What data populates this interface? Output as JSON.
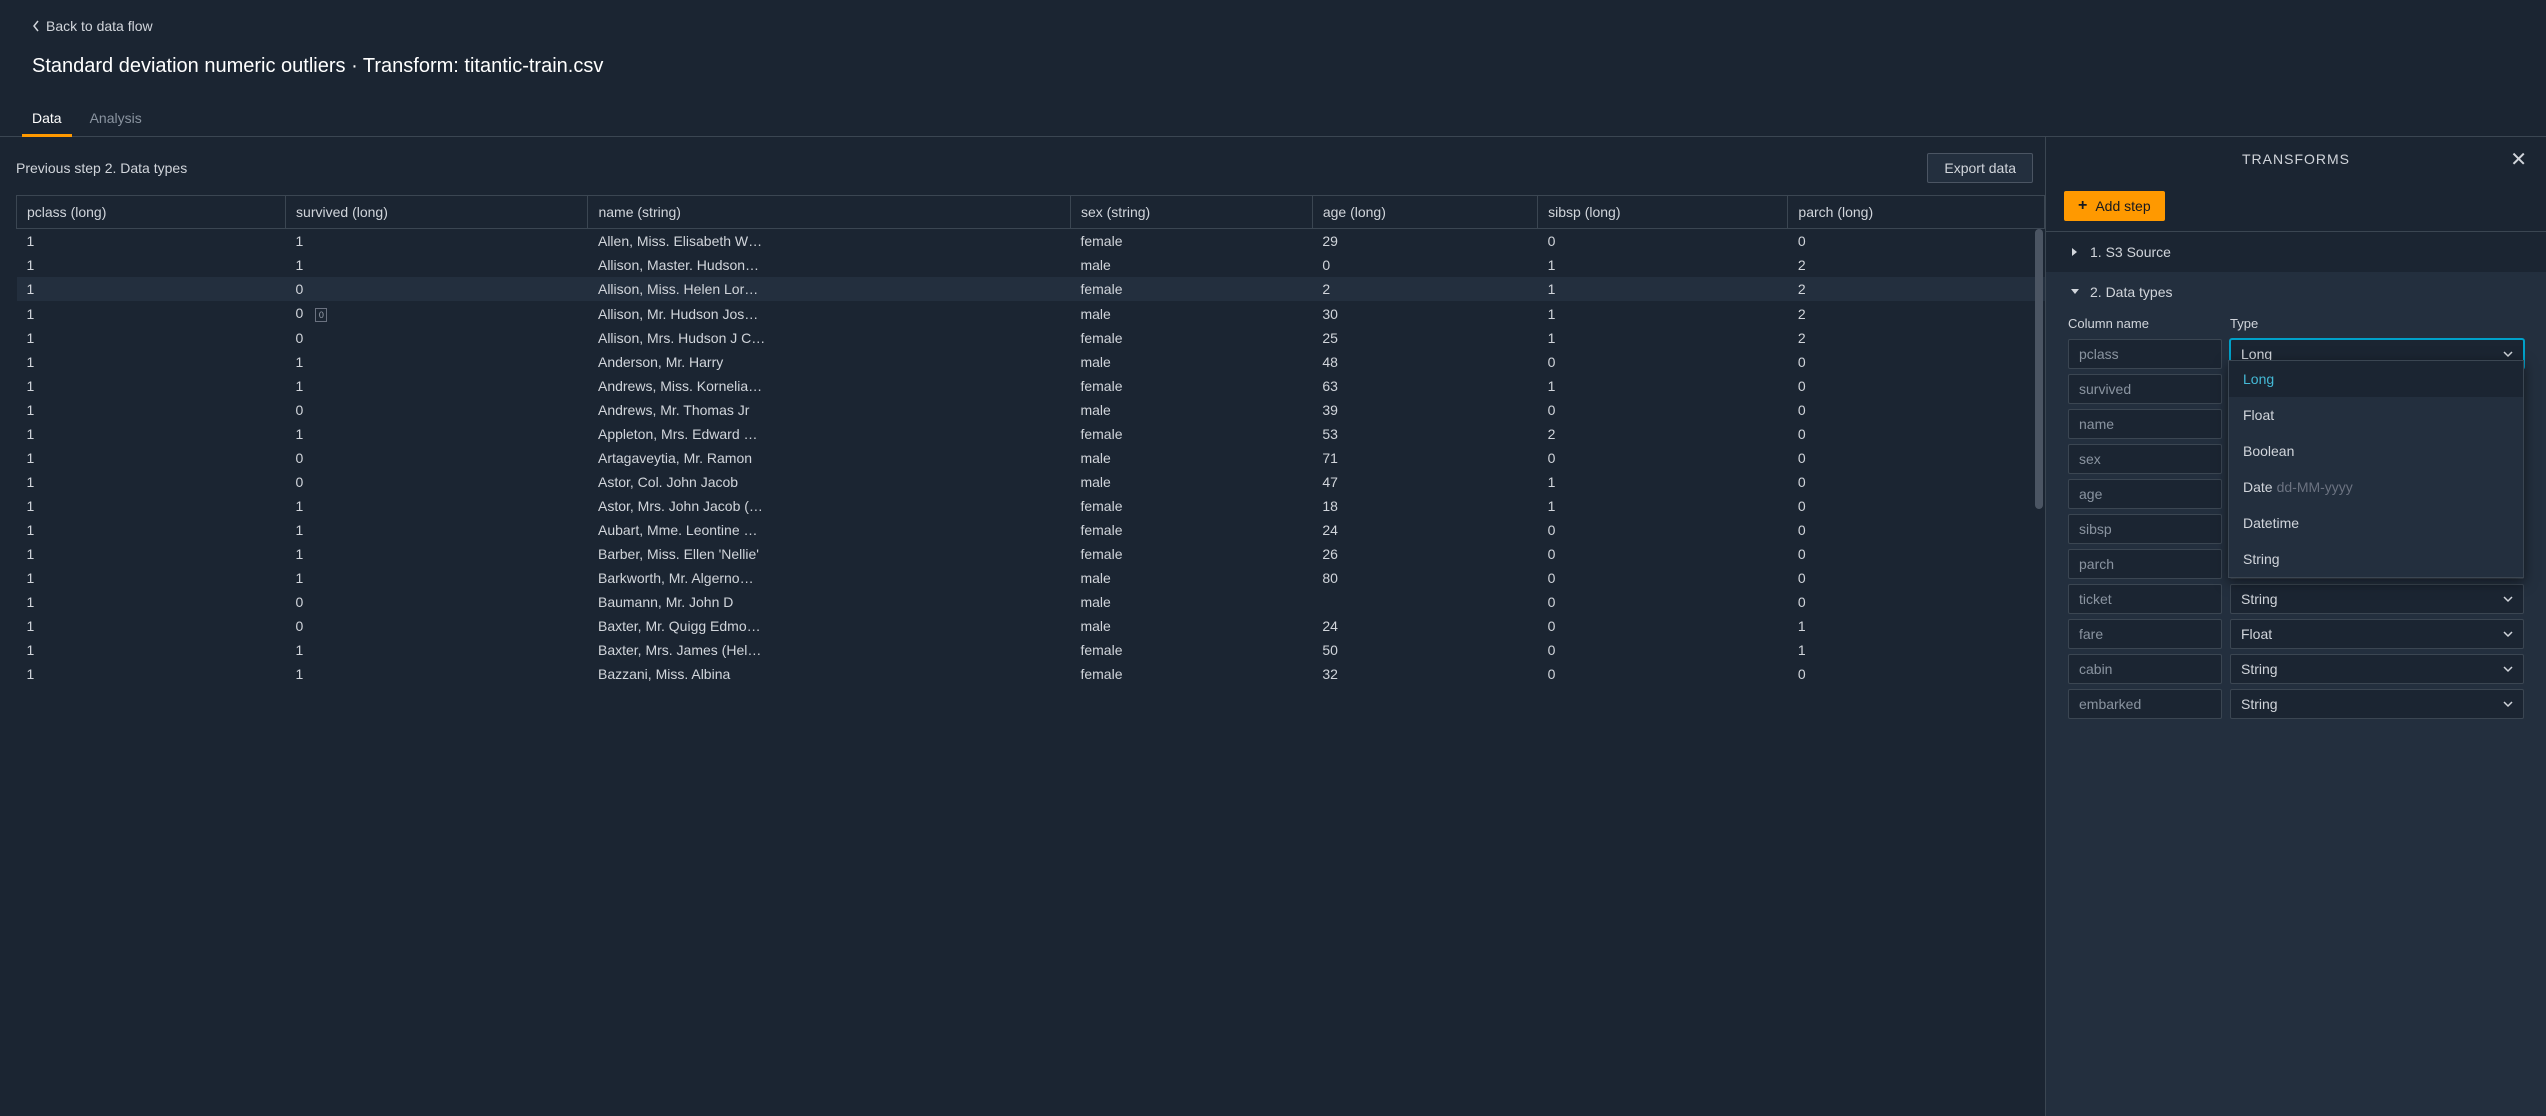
{
  "back_label": "Back to data flow",
  "title": "Standard deviation numeric outliers · Transform: titantic-train.csv",
  "tabs": {
    "data": "Data",
    "analysis": "Analysis"
  },
  "prev_step_label": "Previous step 2. Data types",
  "export_label": "Export data",
  "columns": [
    "pclass (long)",
    "survived (long)",
    "name (string)",
    "sex (string)",
    "age (long)",
    "sibsp (long)",
    "parch (long)"
  ],
  "rows": [
    {
      "pclass": "1",
      "survived": "1",
      "name": "Allen, Miss. Elisabeth W…",
      "sex": "female",
      "age": "29",
      "sibsp": "0",
      "parch": "0"
    },
    {
      "pclass": "1",
      "survived": "1",
      "name": "Allison, Master. Hudson…",
      "sex": "male",
      "age": "0",
      "sibsp": "1",
      "parch": "2"
    },
    {
      "pclass": "1",
      "survived": "0",
      "name": "Allison, Miss. Helen Lor…",
      "sex": "female",
      "age": "2",
      "sibsp": "1",
      "parch": "2",
      "highlight": true
    },
    {
      "pclass": "1",
      "survived": "0",
      "name": "Allison, Mr. Hudson Jos…",
      "sex": "male",
      "age": "30",
      "sibsp": "1",
      "parch": "2",
      "badge": "0"
    },
    {
      "pclass": "1",
      "survived": "0",
      "name": "Allison, Mrs. Hudson J C…",
      "sex": "female",
      "age": "25",
      "sibsp": "1",
      "parch": "2"
    },
    {
      "pclass": "1",
      "survived": "1",
      "name": "Anderson, Mr. Harry",
      "sex": "male",
      "age": "48",
      "sibsp": "0",
      "parch": "0"
    },
    {
      "pclass": "1",
      "survived": "1",
      "name": "Andrews, Miss. Kornelia…",
      "sex": "female",
      "age": "63",
      "sibsp": "1",
      "parch": "0"
    },
    {
      "pclass": "1",
      "survived": "0",
      "name": "Andrews, Mr. Thomas Jr",
      "sex": "male",
      "age": "39",
      "sibsp": "0",
      "parch": "0"
    },
    {
      "pclass": "1",
      "survived": "1",
      "name": "Appleton, Mrs. Edward …",
      "sex": "female",
      "age": "53",
      "sibsp": "2",
      "parch": "0"
    },
    {
      "pclass": "1",
      "survived": "0",
      "name": "Artagaveytia, Mr. Ramon",
      "sex": "male",
      "age": "71",
      "sibsp": "0",
      "parch": "0"
    },
    {
      "pclass": "1",
      "survived": "0",
      "name": "Astor, Col. John Jacob",
      "sex": "male",
      "age": "47",
      "sibsp": "1",
      "parch": "0"
    },
    {
      "pclass": "1",
      "survived": "1",
      "name": "Astor, Mrs. John Jacob (…",
      "sex": "female",
      "age": "18",
      "sibsp": "1",
      "parch": "0"
    },
    {
      "pclass": "1",
      "survived": "1",
      "name": "Aubart, Mme. Leontine …",
      "sex": "female",
      "age": "24",
      "sibsp": "0",
      "parch": "0"
    },
    {
      "pclass": "1",
      "survived": "1",
      "name": "Barber, Miss. Ellen 'Nellie'",
      "sex": "female",
      "age": "26",
      "sibsp": "0",
      "parch": "0"
    },
    {
      "pclass": "1",
      "survived": "1",
      "name": "Barkworth, Mr. Algerno…",
      "sex": "male",
      "age": "80",
      "sibsp": "0",
      "parch": "0"
    },
    {
      "pclass": "1",
      "survived": "0",
      "name": "Baumann, Mr. John D",
      "sex": "male",
      "age": "",
      "sibsp": "0",
      "parch": "0"
    },
    {
      "pclass": "1",
      "survived": "0",
      "name": "Baxter, Mr. Quigg Edmo…",
      "sex": "male",
      "age": "24",
      "sibsp": "0",
      "parch": "1"
    },
    {
      "pclass": "1",
      "survived": "1",
      "name": "Baxter, Mrs. James (Hel…",
      "sex": "female",
      "age": "50",
      "sibsp": "0",
      "parch": "1"
    },
    {
      "pclass": "1",
      "survived": "1",
      "name": "Bazzani, Miss. Albina",
      "sex": "female",
      "age": "32",
      "sibsp": "0",
      "parch": "0"
    }
  ],
  "side": {
    "title": "TRANSFORMS",
    "add_step": "Add step",
    "step1": "1. S3 Source",
    "step2": "2. Data types",
    "col_header": "Column name",
    "type_header": "Type",
    "fields": [
      {
        "name": "pclass",
        "type": "Long",
        "active": true
      },
      {
        "name": "survived",
        "type": ""
      },
      {
        "name": "name",
        "type": ""
      },
      {
        "name": "sex",
        "type": ""
      },
      {
        "name": "age",
        "type": ""
      },
      {
        "name": "sibsp",
        "type": ""
      },
      {
        "name": "parch",
        "type": ""
      },
      {
        "name": "ticket",
        "type": "String"
      },
      {
        "name": "fare",
        "type": "Float"
      },
      {
        "name": "cabin",
        "type": "String"
      },
      {
        "name": "embarked",
        "type": "String"
      }
    ],
    "dropdown": {
      "options": [
        "Long",
        "Float",
        "Boolean",
        "Date",
        "Datetime",
        "String"
      ],
      "date_hint": "dd-MM-yyyy",
      "selected": "Long"
    }
  }
}
